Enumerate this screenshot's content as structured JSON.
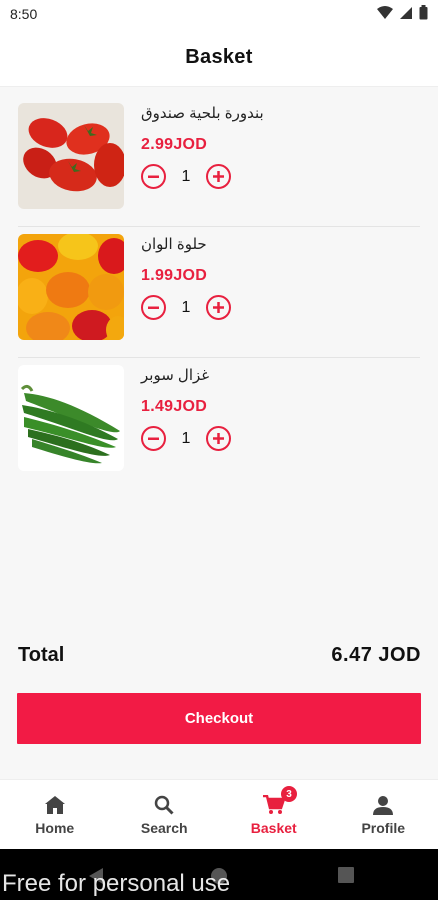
{
  "status": {
    "time": "8:50"
  },
  "header": {
    "title": "Basket"
  },
  "items": [
    {
      "name": "بندورة بلحية صندوق",
      "price": "2.99JOD",
      "qty": "1",
      "image": "tomatoes-image"
    },
    {
      "name": "حلوة الوان",
      "price": "1.99JOD",
      "qty": "1",
      "image": "peppers-image"
    },
    {
      "name": "غزال سوبر",
      "price": "1.49JOD",
      "qty": "1",
      "image": "chili-peppers-image"
    }
  ],
  "total": {
    "label": "Total",
    "value": "6.47 JOD"
  },
  "checkout": {
    "label": "Checkout"
  },
  "nav": [
    {
      "label": "Home",
      "icon": "home-icon"
    },
    {
      "label": "Search",
      "icon": "search-icon"
    },
    {
      "label": "Basket",
      "icon": "cart-icon",
      "active": true,
      "badge": "3"
    },
    {
      "label": "Profile",
      "icon": "person-icon"
    }
  ],
  "watermark": "Free for personal use",
  "colors": {
    "accent": "#e8203f",
    "button": "#f21b45"
  }
}
